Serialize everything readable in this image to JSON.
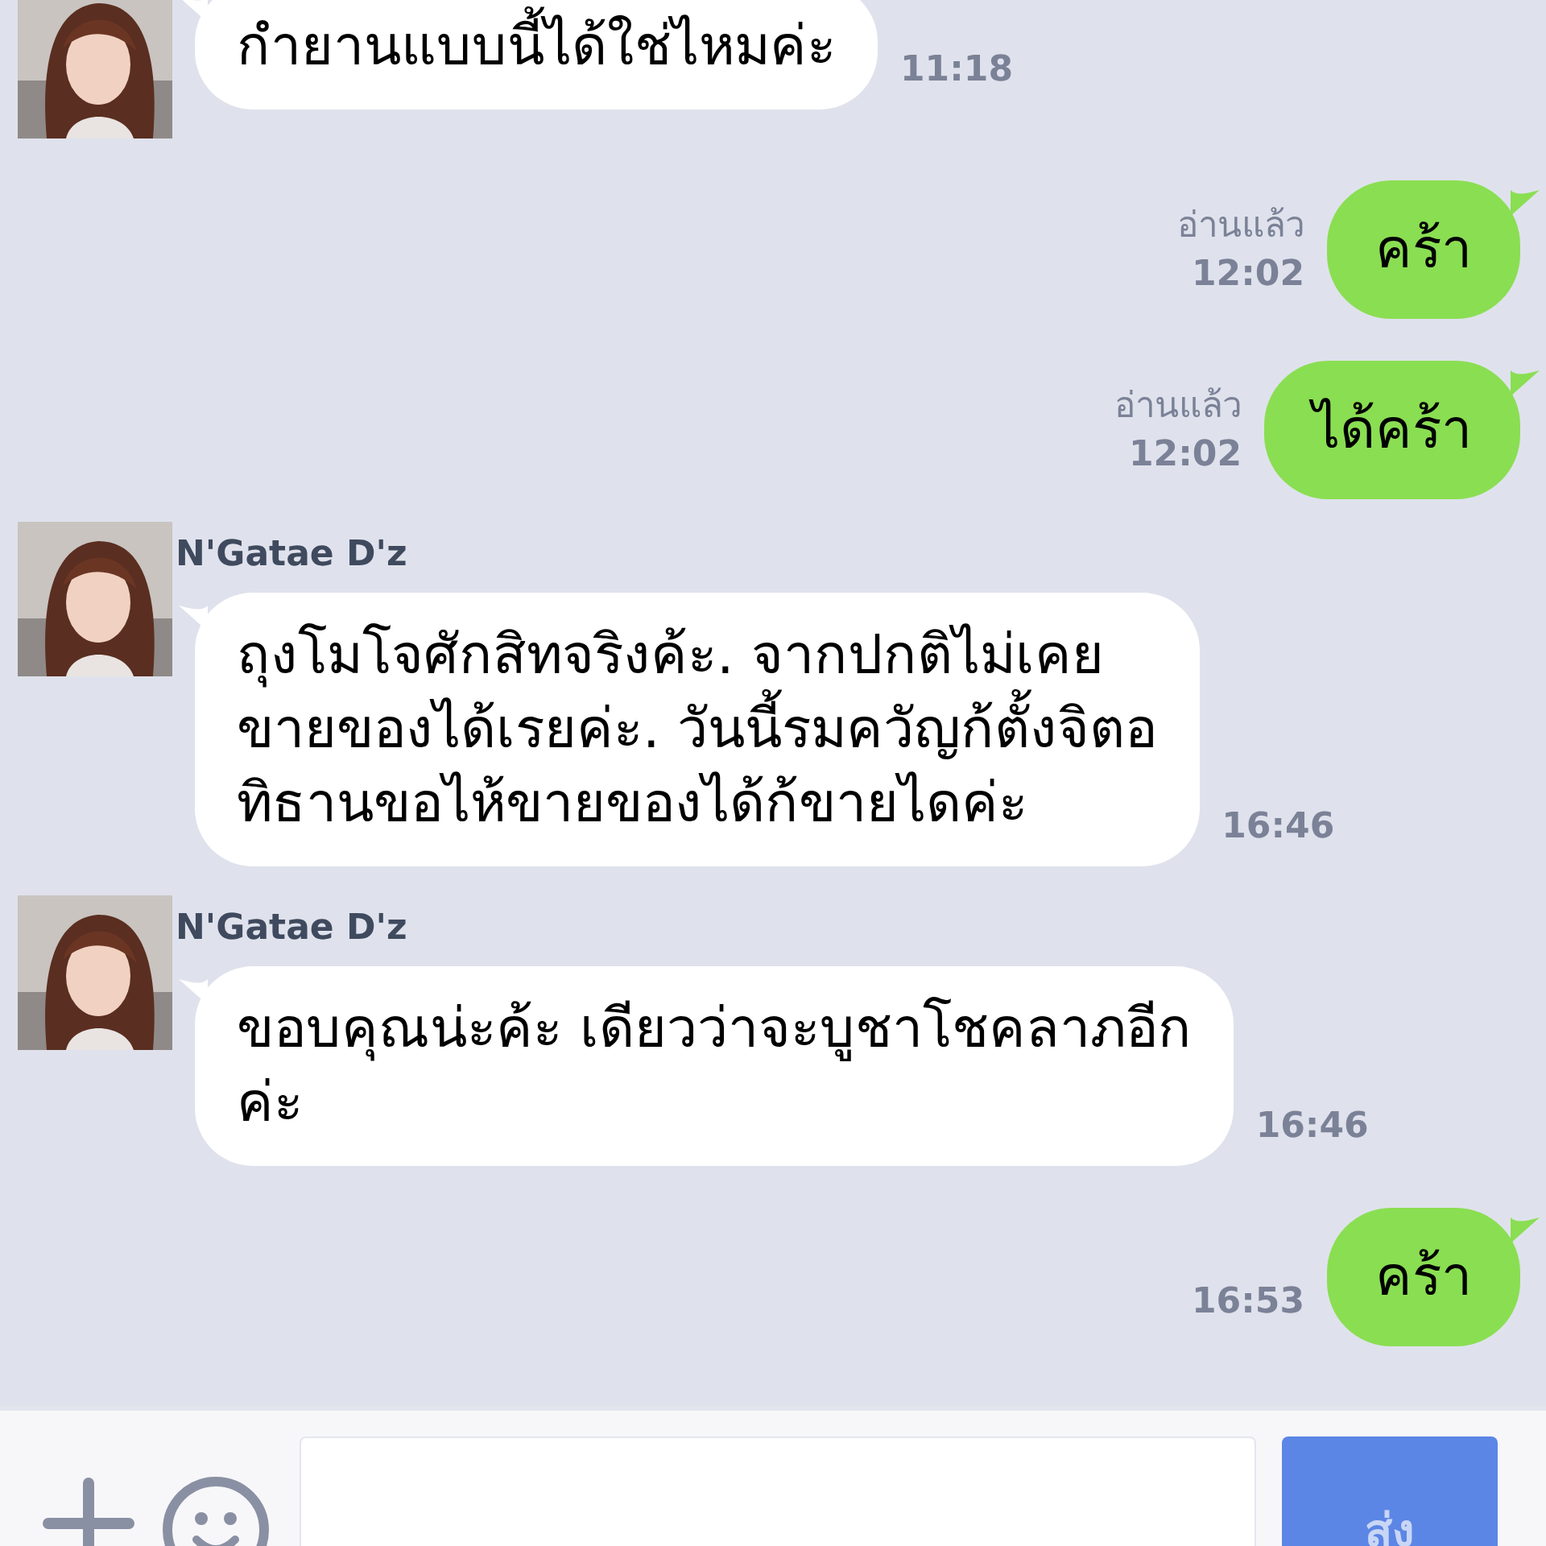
{
  "messages": [
    {
      "kind": "incoming",
      "text": "กำยานแบบนี้ได้ใช่ไหมค่ะ",
      "time": "11:18"
    },
    {
      "kind": "outgoing",
      "read": "อ่านแล้ว",
      "text": "คร้า",
      "time": "12:02"
    },
    {
      "kind": "outgoing",
      "read": "อ่านแล้ว",
      "text": "ได้คร้า",
      "time": "12:02"
    },
    {
      "kind": "incoming",
      "sender": "N'Gatae D'z",
      "text": "ถุงโมโจศักสิทจริงค้ะ. จากปกติไม่เคย\nขายของได้เรยค่ะ. วันนี้รมควัญก้ตั้งจิตอ\nทิธานขอไห้ขายของได้ก้ขายไดค่ะ",
      "time": "16:46"
    },
    {
      "kind": "incoming",
      "sender": "N'Gatae D'z",
      "text": "ขอบคุณน่ะค้ะ เดียวว่าจะบูชาโชคลาภอีก\nค่ะ",
      "time": "16:46"
    },
    {
      "kind": "outgoing",
      "text": "คร้า",
      "time": "16:53"
    }
  ],
  "composer": {
    "send": "ส่ง"
  }
}
